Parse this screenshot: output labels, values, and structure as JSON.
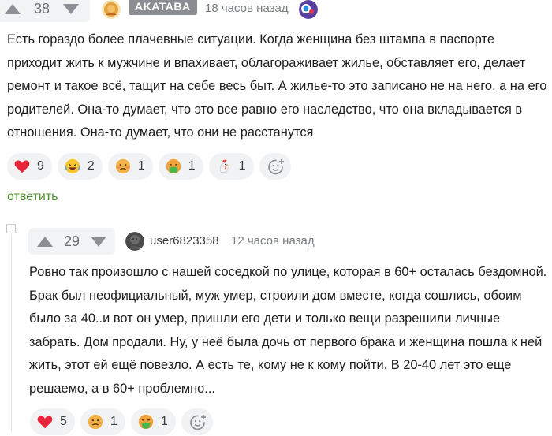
{
  "comments": [
    {
      "score": "38",
      "username": "AKATABA",
      "time": "18 часов назад",
      "text": "Есть гораздо более плачевные ситуации. Когда женщина без штампа в паспорте приходит жить к мужчине и впахивает, облагораживает жилье, обставляет его, делает ремонт и такое всё, тащит на себе весь быт. А жилье-то это записано не на него, а на его родителей. Она-то думает, что это все равно его наследство, что она вкладывается в отношения. Она-то думает, что они не расстанутся",
      "reactions": [
        {
          "icon": "heart-icon",
          "count": "9"
        },
        {
          "icon": "laughing-tears-icon",
          "count": "2"
        },
        {
          "icon": "sad-face-icon",
          "count": "1"
        },
        {
          "icon": "nauseated-face-icon",
          "count": "1"
        },
        {
          "icon": "rooster-icon",
          "count": "1"
        }
      ],
      "reply_label": "ответить"
    },
    {
      "score": "29",
      "username": "user6823358",
      "time": "12 часов назад",
      "text": "Ровно так произошло с нашей соседкой по улице, которая в 60+ осталась бездомной. Брак был неофициальный, муж умер, строили дом вместе, когда сошлись, обоим было за 40..и вот он умер, пришли его дети и только вещи разрешили личные забрать. Дом продали. Ну, у неё была дочь от первого брака и женщина пошла к ней жить, этот ей ещё повезло. А есть те, кому не к кому пойти. В 20-40 лет это еще решаемо, а в 60+ проблемно...",
      "reactions": [
        {
          "icon": "heart-icon",
          "count": "5"
        },
        {
          "icon": "sad-face-icon",
          "count": "1"
        },
        {
          "icon": "nauseated-face-icon",
          "count": "1"
        }
      ]
    }
  ],
  "colors": {
    "reply_link": "#4f8f2c",
    "reaction_bg": "#f1f2f3",
    "arrow": "#8c8f93"
  }
}
